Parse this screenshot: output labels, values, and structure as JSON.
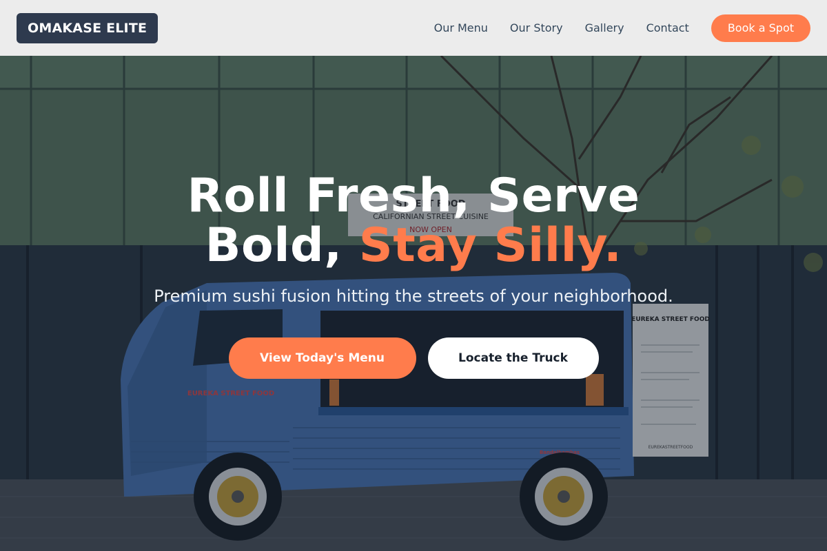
{
  "nav": {
    "logo": "OMAKASE ELITE",
    "links": [
      "Our Menu",
      "Our Story",
      "Gallery",
      "Contact"
    ],
    "cta": "Book a Spot"
  },
  "hero": {
    "title_line1": "Roll Fresh, Serve",
    "title_line2_plain": "Bold, ",
    "title_line2_accent": "Stay Silly.",
    "subtitle": "Premium sushi fusion hitting the streets of your neighborhood.",
    "primary_button": "View Today's Menu",
    "secondary_button": "Locate the Truck",
    "background": {
      "truck_logo": "EUREKA STREET FOOD",
      "truck_brand": "EUREKA STREET FOOD",
      "sign_line1": "STREET FOOD",
      "sign_line2": "CALIFORNIAN STREET CUISINE",
      "sign_line3": "NOW OPEN",
      "sign_logo": "EUREKA STREET FOOD",
      "truck_plate": "Bandalhambas",
      "board_footer": "EUREKASTREETFOOD"
    }
  },
  "colors": {
    "accent": "#ff7c4c",
    "logo_bg": "#2e3a4e",
    "nav_bg": "#ececec"
  }
}
